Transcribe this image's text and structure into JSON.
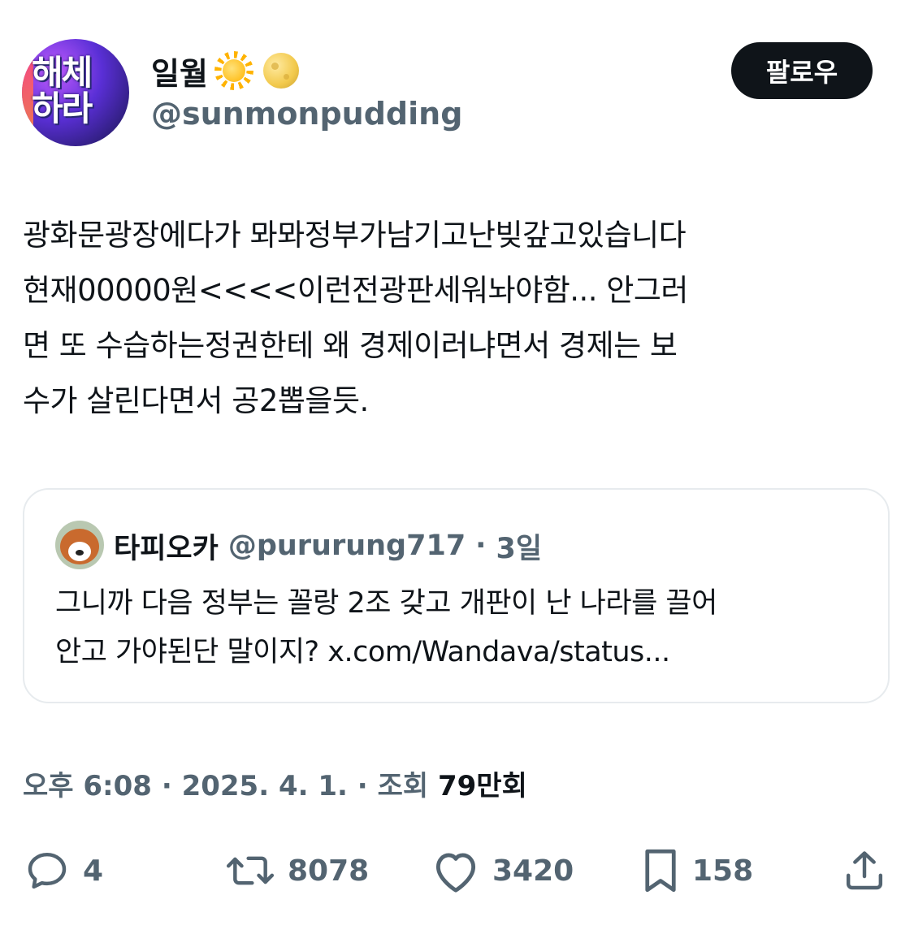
{
  "author": {
    "display_name": "일월",
    "emojis": [
      "sun-emoji",
      "full-moon-emoji"
    ],
    "handle": "@sunmonpudding",
    "avatar_text": [
      "해체",
      "하라"
    ]
  },
  "follow_button": {
    "label": "팔로우"
  },
  "tweet": {
    "lines": [
      "광화문광장에다가 뫄뫄정부가남기고난빚갚고있습니다",
      "현재00000원<<<<이런전광판세워놔야함... 안그러",
      "면 또 수습하는정권한테 왜 경제이러냐면서 경제는 보",
      "수가 살린다면서 공2뽑을듯."
    ]
  },
  "quote": {
    "name": "타피오카",
    "handle": "@pururung717",
    "separator": "·",
    "time": "3일",
    "lines": [
      "그니까 다음 정부는 꼴랑 2조 갖고 개판이 난 나라를 끌어",
      "안고 가야된단 말이지? x.com/Wandava/status..."
    ]
  },
  "meta": {
    "time": "오후 6:08",
    "sep1": "·",
    "date": "2025. 4. 1.",
    "sep2": "·",
    "views_label": "조회",
    "views_count": "79만회"
  },
  "actions": {
    "reply_count": "4",
    "retweet_count": "8078",
    "like_count": "3420",
    "bookmark_count": "158"
  },
  "colors": {
    "text_primary": "#0f1419",
    "text_secondary": "#536471",
    "border": "#e7ebee",
    "follow_bg": "#0f1419"
  }
}
